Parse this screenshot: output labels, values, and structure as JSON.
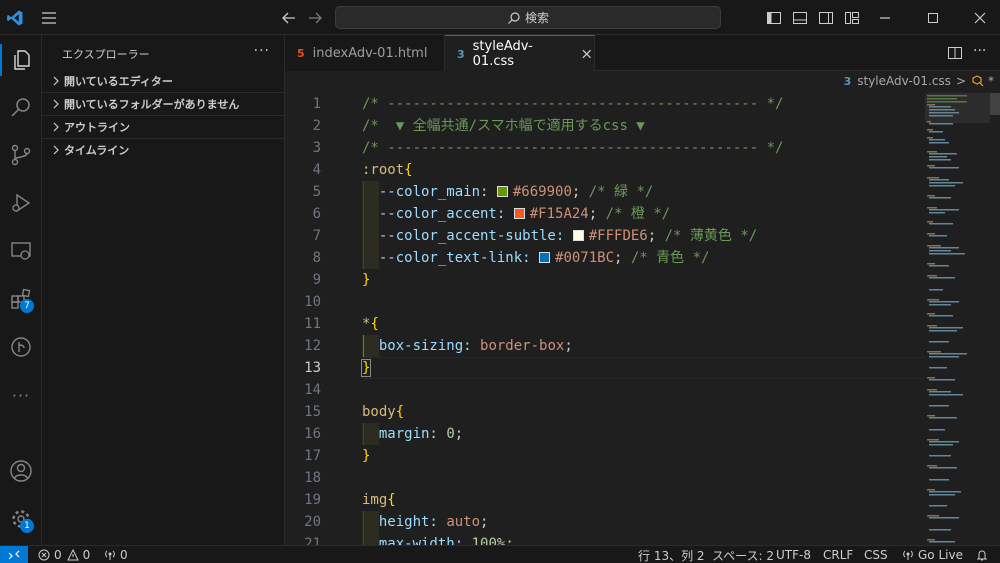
{
  "titlebar": {
    "search_placeholder": "検索"
  },
  "activity": {
    "extensions_badge": "7",
    "settings_badge": "1"
  },
  "sidebar": {
    "header": "エクスプローラー",
    "more": "···",
    "sections": [
      {
        "label": "開いているエディター"
      },
      {
        "label": "開いているフォルダーがありません"
      },
      {
        "label": "アウトライン"
      },
      {
        "label": "タイムライン"
      }
    ]
  },
  "tabs": [
    {
      "label": "indexAdv-01.html",
      "icon": "html5-icon",
      "icon_color": "#e44d26"
    },
    {
      "label": "styleAdv-01.css",
      "icon": "css3-icon",
      "icon_color": "#519aba"
    }
  ],
  "breadcrumb": {
    "file": "styleAdv-01.css",
    "separator": ">",
    "symbol": "*"
  },
  "editor": {
    "line_numbers": [
      "1",
      "2",
      "3",
      "4",
      "5",
      "6",
      "7",
      "8",
      "9",
      "10",
      "11",
      "12",
      "13",
      "14",
      "15",
      "16",
      "17",
      "18",
      "19",
      "20",
      "21"
    ],
    "current_line": "13",
    "lines": {
      "l1": "/* -------------------------------------------- */",
      "l2": "/*  ▼ 全幅共通/スマホ幅で適用するcss ▼",
      "l3": "/* -------------------------------------------- */",
      "l4_sel": ":root",
      "l4_brace": "{",
      "l5_prop": "--color_main:",
      "l5_val": "#669900",
      "l5_comment": "/* 緑 */",
      "l6_prop": "--color_accent:",
      "l6_val": "#F15A24",
      "l6_comment": "/* 橙 */",
      "l7_prop": "--color_accent-subtle:",
      "l7_val": "#FFFDE6",
      "l7_comment": "/* 薄黄色 */",
      "l8_prop": "--color_text-link:",
      "l8_val": "#0071BC",
      "l8_comment": "/* 青色 */",
      "l9_brace": "}",
      "l11_sel": "*",
      "l11_brace": "{",
      "l12_prop": "box-sizing:",
      "l12_val": "border-box",
      "l13_brace": "}",
      "l15_sel": "body",
      "l15_brace": "{",
      "l16_prop": "margin:",
      "l16_val": "0",
      "l17_brace": "}",
      "l19_sel": "img",
      "l19_brace": "{",
      "l20_prop": "height:",
      "l20_val": "auto",
      "l21_prop": "max-width:",
      "l21_val": "100%"
    },
    "swatches": {
      "main": "#669900",
      "accent": "#F15A24",
      "subtle": "#FFFDE6",
      "link": "#0071BC"
    }
  },
  "statusbar": {
    "errors": "0",
    "warnings": "0",
    "ports": "0",
    "position": "行 13、列 2",
    "spaces": "スペース: 2",
    "encoding": "UTF-8",
    "eol": "CRLF",
    "language": "CSS",
    "golive": "Go Live"
  },
  "colors": {
    "accent": "#0078d4",
    "editor_bg": "#1f1f1f",
    "chrome_bg": "#181818"
  }
}
